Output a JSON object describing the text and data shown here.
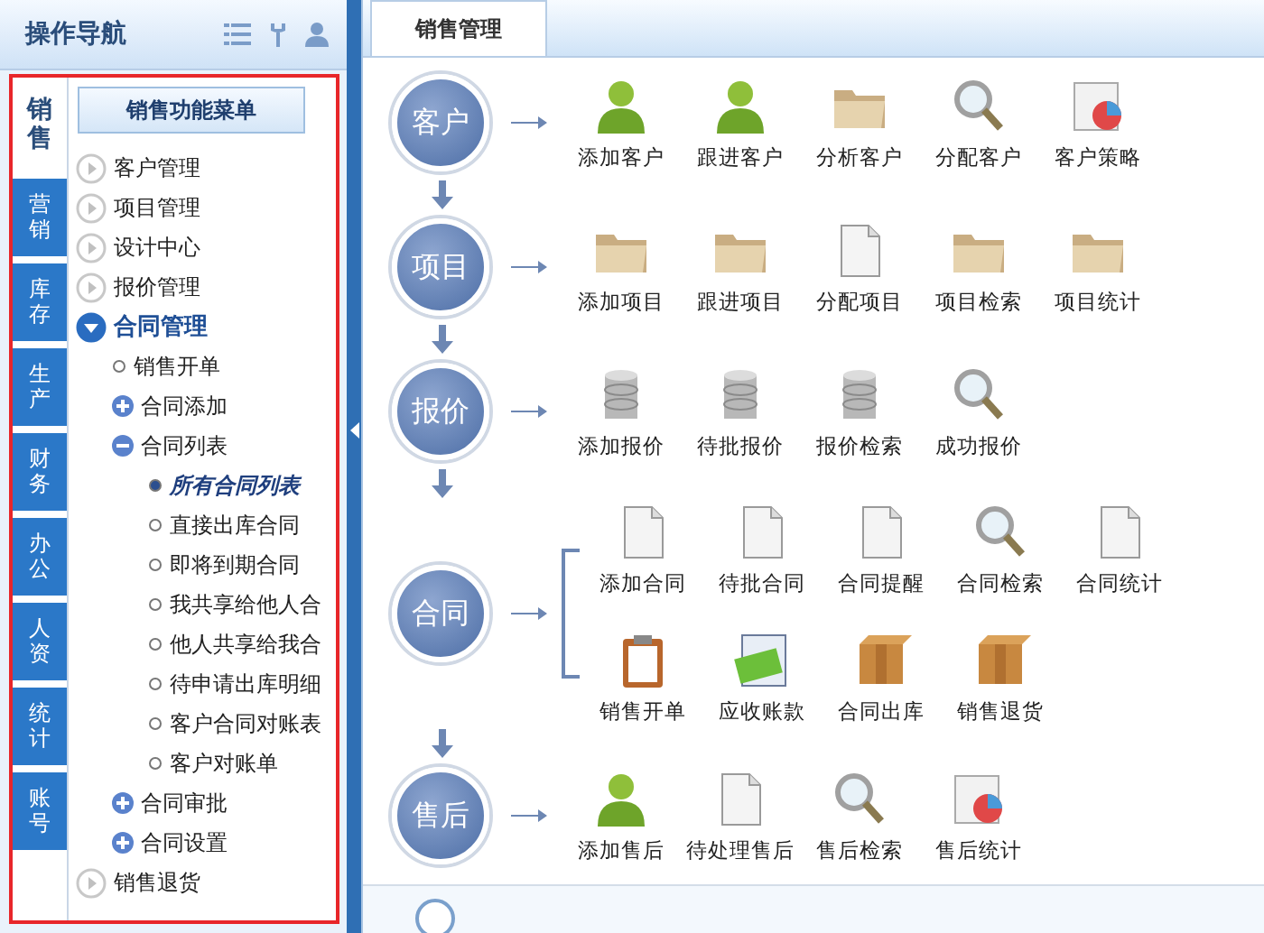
{
  "sidebar": {
    "title": "操作导航",
    "tabs": [
      {
        "label": "销售",
        "selected": true
      },
      {
        "label": "营销",
        "selected": false
      },
      {
        "label": "库存",
        "selected": false
      },
      {
        "label": "生产",
        "selected": false
      },
      {
        "label": "财务",
        "selected": false
      },
      {
        "label": "办公",
        "selected": false
      },
      {
        "label": "人资",
        "selected": false
      },
      {
        "label": "统计",
        "selected": false
      },
      {
        "label": "账号",
        "selected": false
      }
    ],
    "menu_button": "销售功能菜单",
    "tree": [
      {
        "label": "客户管理",
        "expanded": false
      },
      {
        "label": "项目管理",
        "expanded": false
      },
      {
        "label": "设计中心",
        "expanded": false
      },
      {
        "label": "报价管理",
        "expanded": false
      },
      {
        "label": "合同管理",
        "expanded": true,
        "children": [
          {
            "label": "销售开单",
            "selected": false
          },
          {
            "label": "合同添加",
            "expanded": false
          },
          {
            "label": "合同列表",
            "expanded": true,
            "children": [
              {
                "label": "所有合同列表",
                "selected": true
              },
              {
                "label": "直接出库合同",
                "selected": false
              },
              {
                "label": "即将到期合同",
                "selected": false
              },
              {
                "label": "我共享给他人合",
                "selected": false
              },
              {
                "label": "他人共享给我合",
                "selected": false
              },
              {
                "label": "待申请出库明细",
                "selected": false
              },
              {
                "label": "客户合同对账表",
                "selected": false
              },
              {
                "label": "客户对账单",
                "selected": false
              }
            ]
          },
          {
            "label": "合同审批",
            "expanded": false
          },
          {
            "label": "合同设置",
            "expanded": false
          }
        ]
      },
      {
        "label": "销售退货",
        "expanded": false
      }
    ]
  },
  "main": {
    "tabs": [
      {
        "label": "销售管理",
        "selected": true
      }
    ],
    "stages": [
      {
        "label": "客户",
        "rows": [
          [
            {
              "label": "添加客户",
              "kind": "person"
            },
            {
              "label": "跟进客户",
              "kind": "person"
            },
            {
              "label": "分析客户",
              "kind": "folder"
            },
            {
              "label": "分配客户",
              "kind": "search"
            },
            {
              "label": "客户策略",
              "kind": "chart"
            }
          ]
        ]
      },
      {
        "label": "项目",
        "rows": [
          [
            {
              "label": "添加项目",
              "kind": "folder"
            },
            {
              "label": "跟进项目",
              "kind": "folder"
            },
            {
              "label": "分配项目",
              "kind": "document"
            },
            {
              "label": "项目检索",
              "kind": "folder"
            },
            {
              "label": "项目统计",
              "kind": "folder"
            }
          ]
        ]
      },
      {
        "label": "报价",
        "rows": [
          [
            {
              "label": "添加报价",
              "kind": "database"
            },
            {
              "label": "待批报价",
              "kind": "database"
            },
            {
              "label": "报价检索",
              "kind": "database"
            },
            {
              "label": "成功报价",
              "kind": "search"
            }
          ]
        ]
      },
      {
        "label": "合同",
        "rows": [
          [
            {
              "label": "添加合同",
              "kind": "document"
            },
            {
              "label": "待批合同",
              "kind": "document"
            },
            {
              "label": "合同提醒",
              "kind": "document"
            },
            {
              "label": "合同检索",
              "kind": "search"
            },
            {
              "label": "合同统计",
              "kind": "document"
            }
          ],
          [
            {
              "label": "销售开单",
              "kind": "clipboard"
            },
            {
              "label": "应收账款",
              "kind": "money"
            },
            {
              "label": "合同出库",
              "kind": "box"
            },
            {
              "label": "销售退货",
              "kind": "box"
            }
          ]
        ]
      },
      {
        "label": "售后",
        "rows": [
          [
            {
              "label": "添加售后",
              "kind": "person"
            },
            {
              "label": "待处理售后",
              "kind": "document"
            },
            {
              "label": "售后检索",
              "kind": "search"
            },
            {
              "label": "售后统计",
              "kind": "chart"
            }
          ]
        ]
      }
    ]
  }
}
